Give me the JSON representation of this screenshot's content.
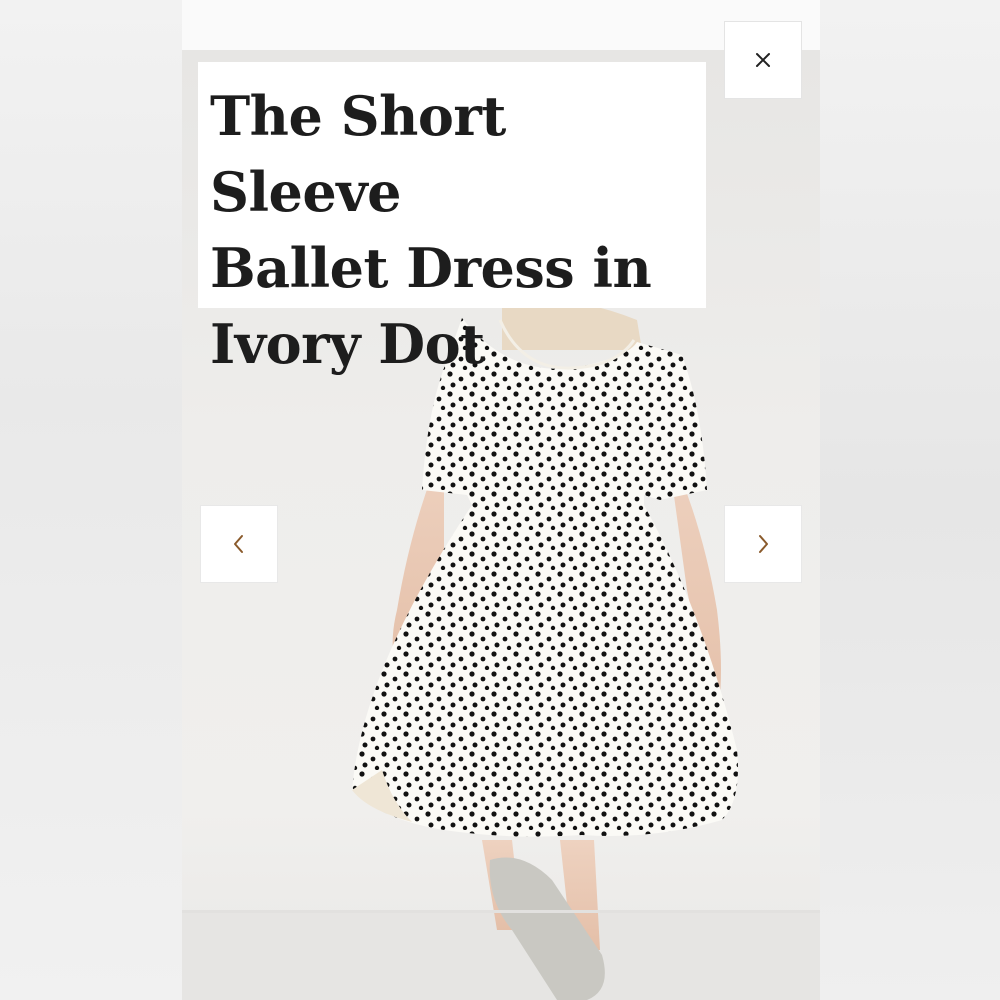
{
  "product": {
    "title_line1": "The Short Sleeve",
    "title_line2": "Ballet Dress in",
    "title_line3": "Ivory Dot"
  },
  "icons": {
    "close": "close-icon",
    "prev": "chevron-left-icon",
    "next": "chevron-right-icon"
  },
  "colors": {
    "accent": "#8a5a2b",
    "title_text": "#1d1d1d",
    "dress_dot": "#111111",
    "dress_fabric": "#fbfaf6"
  }
}
